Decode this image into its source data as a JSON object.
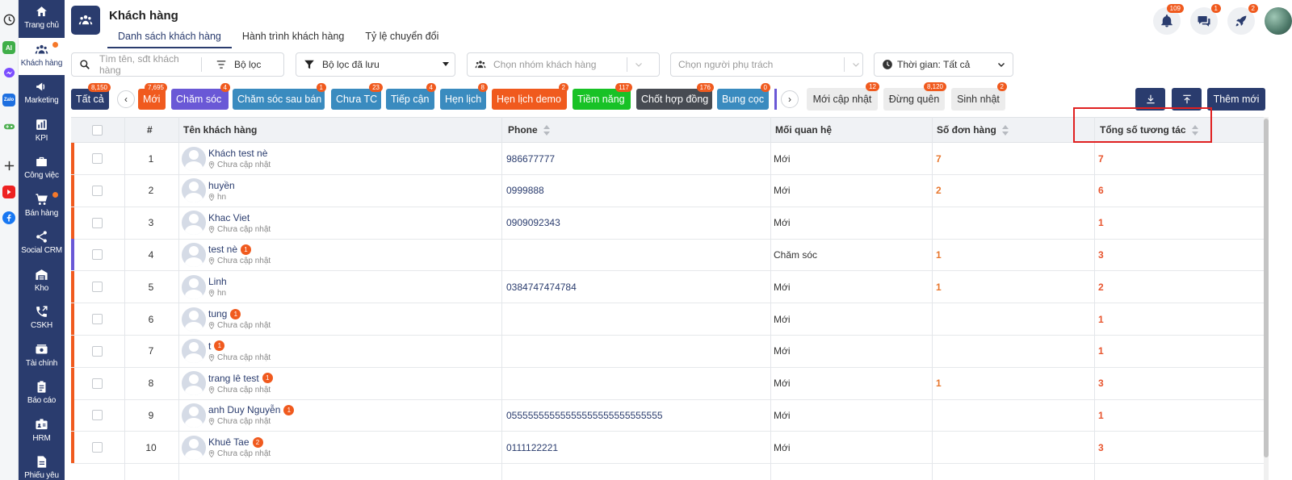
{
  "nav": [
    {
      "label": "Trang chủ",
      "icon": "home-icon"
    },
    {
      "label": "Khách hàng",
      "icon": "customers-icon",
      "active": true,
      "dot": true
    },
    {
      "label": "Marketing",
      "icon": "megaphone-icon"
    },
    {
      "label": "KPI",
      "icon": "chart-icon"
    },
    {
      "label": "Công việc",
      "icon": "briefcase-icon"
    },
    {
      "label": "Bán hàng",
      "icon": "cart-icon",
      "dot": true
    },
    {
      "label": "Social CRM",
      "icon": "share-icon"
    },
    {
      "label": "Kho",
      "icon": "warehouse-icon"
    },
    {
      "label": "CSKH",
      "icon": "phone-icon"
    },
    {
      "label": "Tài chính",
      "icon": "money-icon"
    },
    {
      "label": "Báo cáo",
      "icon": "clipboard-icon"
    },
    {
      "label": "HRM",
      "icon": "id-card-icon"
    },
    {
      "label": "Phiếu yêu",
      "icon": "document-icon"
    }
  ],
  "extensions": [
    "clock-icon",
    "AI",
    "messenger-icon",
    "Zalo",
    "game-icon",
    "plus-icon",
    "youtube-icon",
    "facebook-icon"
  ],
  "header": {
    "title": "Khách hàng",
    "tabs": [
      "Danh sách khách hàng",
      "Hành trình khách hàng",
      "Tỷ lệ chuyển đổi"
    ],
    "notif_count": "109",
    "chat_count": "1",
    "rocket_count": "2"
  },
  "filters": {
    "search_placeholder": "Tìm tên, sđt khách hàng",
    "filter_label": "Bộ lọc",
    "saved_filter_label": "Bộ lọc đã lưu",
    "group_placeholder": "Chọn nhóm khách hàng",
    "owner_placeholder": "Chọn người phụ trách",
    "time_label": "Thời gian: Tất cả"
  },
  "chips": [
    {
      "label": "Tất cả",
      "count": "8,150",
      "color": "#2a3c6e"
    },
    {
      "label": "Mới",
      "count": "7,695",
      "color": "#f05a1e"
    },
    {
      "label": "Chăm sóc",
      "count": "4",
      "color": "#6a58d6"
    },
    {
      "label": "Chăm sóc sau bán",
      "count": "1",
      "color": "#3a8bbf"
    },
    {
      "label": "Chưa TC",
      "count": "23",
      "color": "#3a8bbf"
    },
    {
      "label": "Tiếp cận",
      "count": "4",
      "color": "#3a8bbf"
    },
    {
      "label": "Hẹn lịch",
      "count": "8",
      "color": "#3a8bbf"
    },
    {
      "label": "Hẹn lịch demo",
      "count": "2",
      "color": "#f05a1e"
    },
    {
      "label": "Tiềm năng",
      "count": "117",
      "color": "#18c226"
    },
    {
      "label": "Chốt hợp đồng",
      "count": "176",
      "color": "#474b52"
    },
    {
      "label": "Bung cọc",
      "count": "0",
      "color": "#3a8bbf"
    }
  ],
  "quick_filters": [
    {
      "label": "Mới cập nhật",
      "count": "12"
    },
    {
      "label": "Đừng quên",
      "count": "8,120"
    },
    {
      "label": "Sinh nhật",
      "count": "2"
    }
  ],
  "actions": {
    "add_new": "Thêm mới"
  },
  "table": {
    "columns": [
      "#",
      "Tên khách hàng",
      "Phone",
      "Mối quan hệ",
      "Số đơn hàng",
      "Tổng số tương tác"
    ],
    "rows": [
      {
        "no": "1",
        "name": "Khách test nè",
        "badge": "",
        "addr": "Chưa cập nhật",
        "phone": "986677777",
        "relation": "Mới",
        "orders": "7",
        "interactions": "7",
        "marker": "#f05a1e"
      },
      {
        "no": "2",
        "name": "huyền",
        "badge": "",
        "addr": "hn",
        "phone": "0999888",
        "relation": "Mới",
        "orders": "2",
        "interactions": "6",
        "marker": "#f05a1e"
      },
      {
        "no": "3",
        "name": "Khac Viet",
        "badge": "",
        "addr": "Chưa cập nhật",
        "phone": "0909092343",
        "relation": "Mới",
        "orders": "",
        "interactions": "1",
        "marker": "#f05a1e"
      },
      {
        "no": "4",
        "name": "test nè",
        "badge": "1",
        "addr": "Chưa cập nhật",
        "phone": "",
        "relation": "Chăm sóc",
        "orders": "1",
        "interactions": "3",
        "marker": "#6a58d6"
      },
      {
        "no": "5",
        "name": "Linh",
        "badge": "",
        "addr": "hn",
        "phone": "0384747474784",
        "relation": "Mới",
        "orders": "1",
        "interactions": "2",
        "marker": "#f05a1e"
      },
      {
        "no": "6",
        "name": "tung",
        "badge": "1",
        "addr": "Chưa cập nhật",
        "phone": "",
        "relation": "Mới",
        "orders": "",
        "interactions": "1",
        "marker": "#f05a1e"
      },
      {
        "no": "7",
        "name": "t",
        "badge": "1",
        "addr": "Chưa cập nhật",
        "phone": "",
        "relation": "Mới",
        "orders": "",
        "interactions": "1",
        "marker": "#f05a1e"
      },
      {
        "no": "8",
        "name": "trang lê test",
        "badge": "1",
        "addr": "Chưa cập nhật",
        "phone": "",
        "relation": "Mới",
        "orders": "1",
        "interactions": "3",
        "marker": "#f05a1e"
      },
      {
        "no": "9",
        "name": "anh Duy Nguyễn",
        "badge": "1",
        "addr": "Chưa cập nhật",
        "phone": "05555555555555555555555555555",
        "relation": "Mới",
        "orders": "",
        "interactions": "1",
        "marker": "#f05a1e"
      },
      {
        "no": "10",
        "name": "Khuê Tae",
        "badge": "2",
        "addr": "Chưa cập nhật",
        "phone": "0111122221",
        "relation": "Mới",
        "orders": "",
        "interactions": "3",
        "marker": "#f05a1e"
      }
    ]
  }
}
